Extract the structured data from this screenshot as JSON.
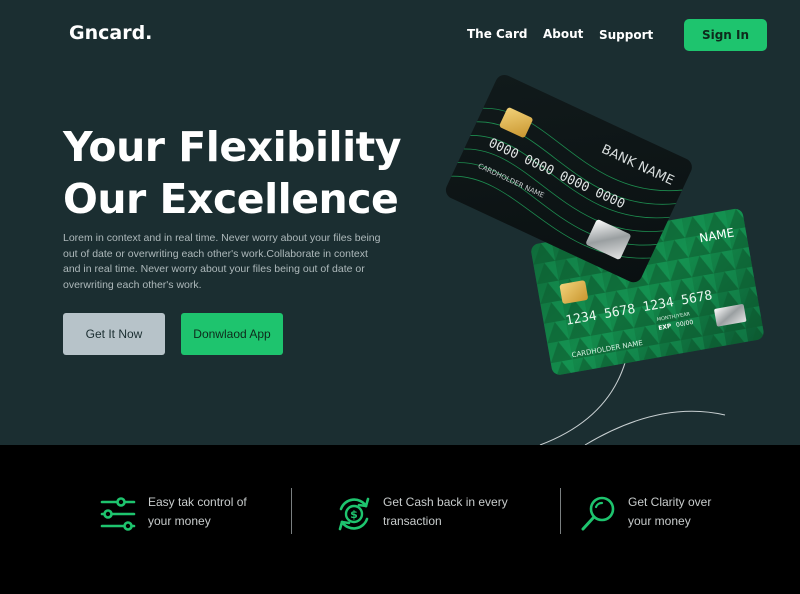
{
  "brand": {
    "logo": "Gncard."
  },
  "nav": {
    "items": [
      {
        "label": "The Card"
      },
      {
        "label": "About"
      },
      {
        "label": "Support"
      }
    ],
    "signin_label": "Sign In"
  },
  "hero": {
    "headline_line1": "Your Flexibility",
    "headline_line2": "Our Excellence",
    "lede": "Lorem in context and in real time. Never worry about your files being out of date or overwriting each other's work.Collaborate in context and in real time. Never worry about your files being out of date or overwriting each other's work.",
    "primary_button": "Get It Now",
    "secondary_button": "Donwlaod App"
  },
  "cards": {
    "dark_card": {
      "number": "0000 0000 0000 0000",
      "bank": "BANK NAME",
      "holder": "CARDHOLDER NAME"
    },
    "green_card": {
      "number": "1234 5678 1234 5678",
      "bank": "NAME",
      "holder": "CARDHOLDER NAME",
      "valid_label": "MONTH/YEAR",
      "exp_label": "EXP",
      "exp_value": "00/00"
    }
  },
  "features": [
    {
      "icon": "sliders-icon",
      "text": "Easy tak control of\nyour money"
    },
    {
      "icon": "cashback-icon",
      "text": "Get Cash back in every\ntransaction"
    },
    {
      "icon": "magnifier-icon",
      "text": "Get Clarity over\nyour money"
    }
  ],
  "colors": {
    "hero_bg": "#1b2e31",
    "accent": "#1ec46e",
    "footer_bg": "#000000",
    "button_grey": "#b7c3c9"
  }
}
